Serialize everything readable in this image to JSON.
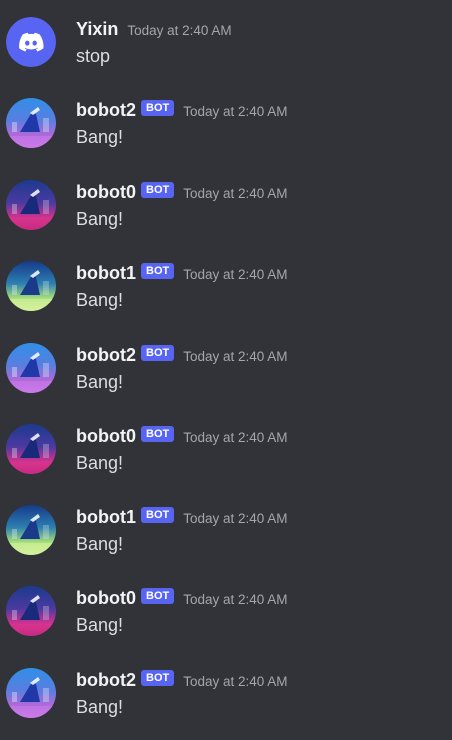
{
  "colors": {
    "background": "#313338",
    "blurple": "#5865f2",
    "username": "#f2f3f5",
    "message": "#dbdee1",
    "timestamp": "#a3a6aa"
  },
  "messages": [
    {
      "author": "Yixin",
      "bot": false,
      "timestamp": "Today at 2:40 AM",
      "text": "stop",
      "avatar": "discord-logo-icon"
    },
    {
      "author": "bobot2",
      "bot": true,
      "bot_label": "BOT",
      "timestamp": "Today at 2:40 AM",
      "text": "Bang!",
      "avatar": "bobot2-avatar-icon"
    },
    {
      "author": "bobot0",
      "bot": true,
      "bot_label": "BOT",
      "timestamp": "Today at 2:40 AM",
      "text": "Bang!",
      "avatar": "bobot0-avatar-icon"
    },
    {
      "author": "bobot1",
      "bot": true,
      "bot_label": "BOT",
      "timestamp": "Today at 2:40 AM",
      "text": "Bang!",
      "avatar": "bobot1-avatar-icon"
    },
    {
      "author": "bobot2",
      "bot": true,
      "bot_label": "BOT",
      "timestamp": "Today at 2:40 AM",
      "text": "Bang!",
      "avatar": "bobot2-avatar-icon"
    },
    {
      "author": "bobot0",
      "bot": true,
      "bot_label": "BOT",
      "timestamp": "Today at 2:40 AM",
      "text": "Bang!",
      "avatar": "bobot0-avatar-icon"
    },
    {
      "author": "bobot1",
      "bot": true,
      "bot_label": "BOT",
      "timestamp": "Today at 2:40 AM",
      "text": "Bang!",
      "avatar": "bobot1-avatar-icon"
    },
    {
      "author": "bobot0",
      "bot": true,
      "bot_label": "BOT",
      "timestamp": "Today at 2:40 AM",
      "text": "Bang!",
      "avatar": "bobot0-avatar-icon"
    },
    {
      "author": "bobot2",
      "bot": true,
      "bot_label": "BOT",
      "timestamp": "Today at 2:40 AM",
      "text": "Bang!",
      "avatar": "bobot2-avatar-icon"
    }
  ]
}
